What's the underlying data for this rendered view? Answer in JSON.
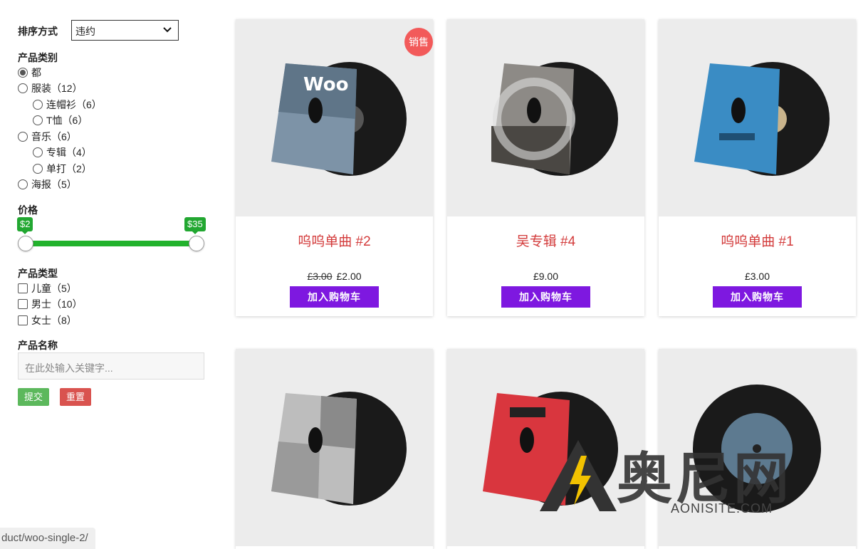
{
  "sort": {
    "label": "排序方式",
    "value": "违约"
  },
  "category": {
    "label": "产品类别",
    "items": [
      {
        "text": "都",
        "checked": true
      },
      {
        "text": "服装（12）"
      },
      {
        "text": "连帽衫（6）"
      },
      {
        "text": "T恤（6）"
      },
      {
        "text": "音乐（6）"
      },
      {
        "text": "专辑（4）"
      },
      {
        "text": "单打（2）"
      },
      {
        "text": "海报（5）"
      }
    ]
  },
  "price": {
    "label": "价格",
    "min": "$2",
    "max": "$35"
  },
  "type": {
    "label": "产品类型",
    "items": [
      {
        "text": "儿童（5）"
      },
      {
        "text": "男士（10）"
      },
      {
        "text": "女士（8）"
      }
    ]
  },
  "name": {
    "label": "产品名称",
    "placeholder": "在此处输入关键字..."
  },
  "buttons": {
    "submit": "提交",
    "reset": "重置",
    "submit_color": "#5cb85c",
    "reset_color": "#d9534f"
  },
  "products": [
    {
      "title": "呜呜单曲 #2",
      "old_price": "£3.00",
      "price": "£2.00",
      "cart": "加入购物车",
      "sale": "销售"
    },
    {
      "title": "吴专辑 #4",
      "price": "£9.00",
      "cart": "加入购物车"
    },
    {
      "title": "呜呜单曲 #1",
      "price": "£3.00",
      "cart": "加入购物车"
    }
  ],
  "status_url": "duct/woo-single-2/",
  "watermark": {
    "text": "奥尼网",
    "sub": "AONISITE.COM"
  },
  "colors": {
    "accent": "#7e18e0",
    "title": "#d33b3b",
    "slider": "#22b22c",
    "sale": "#f25a5a"
  }
}
